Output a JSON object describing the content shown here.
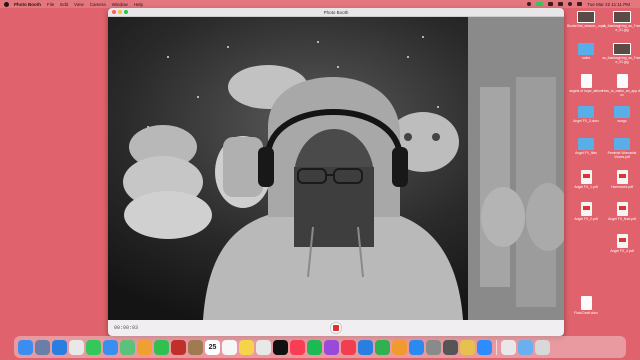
{
  "menubar": {
    "app": "Photo Booth",
    "items": [
      "File",
      "Edit",
      "View",
      "Camera",
      "Window",
      "Help"
    ],
    "clock": "Tue Mar 22 11:11 PM"
  },
  "window": {
    "title": "Photo Booth",
    "timer": "00:00:03"
  },
  "desktop_icons": [
    {
      "label": "Bucket list_season_.mp4",
      "type": "thumb"
    },
    {
      "label": "ss_thanksgiving_ss_Frame_01.jpg",
      "type": "thumb"
    },
    {
      "label": "notes",
      "type": "folder"
    },
    {
      "label": "ss_thanksgiving_ss_Frame_02.jpg",
      "type": "thumb"
    },
    {
      "label": "angels of hope_album",
      "type": "doc"
    },
    {
      "label": "How_to_make_an_app.docx",
      "type": "doc"
    },
    {
      "label": "Angel FX_3.docx",
      "type": "folder"
    },
    {
      "label": "songs",
      "type": "folder"
    },
    {
      "label": "Angel FX_files",
      "type": "folder"
    },
    {
      "label": "Feminist Womanist Voices.pdf",
      "type": "folder"
    },
    {
      "label": "Angel FX_1.pdf",
      "type": "pdf"
    },
    {
      "label": "Homework.pdf",
      "type": "pdf"
    },
    {
      "label": "Angel FX_2.pdf",
      "type": "pdf"
    },
    {
      "label": "Angel FX_final.pdf",
      "type": "pdf"
    },
    {
      "label": "Angel FX_4.pdf",
      "type": "pdf"
    },
    {
      "label": "Final Draft.docx",
      "type": "doc"
    }
  ],
  "dock": [
    {
      "name": "Finder",
      "color": "#3b8ef0"
    },
    {
      "name": "Launchpad",
      "color": "#6a7fa8"
    },
    {
      "name": "Safari",
      "color": "#2a7ee0"
    },
    {
      "name": "Chrome",
      "color": "#e8e8e8"
    },
    {
      "name": "Messages",
      "color": "#34c759"
    },
    {
      "name": "Mail",
      "color": "#3a8ef0"
    },
    {
      "name": "Maps",
      "color": "#5cc17a"
    },
    {
      "name": "Photos",
      "color": "#f0a030"
    },
    {
      "name": "FaceTime",
      "color": "#30c050"
    },
    {
      "name": "Photo Booth",
      "color": "#c0302a"
    },
    {
      "name": "Contacts",
      "color": "#a07a50"
    },
    {
      "name": "Calendar",
      "color": "#ffffff",
      "text": "25"
    },
    {
      "name": "Reminders",
      "color": "#f6f6f6"
    },
    {
      "name": "Notes",
      "color": "#f5d34a"
    },
    {
      "name": "Freeform",
      "color": "#e8e8e8"
    },
    {
      "name": "Apple TV",
      "color": "#111111"
    },
    {
      "name": "Music",
      "color": "#fa3c54"
    },
    {
      "name": "Spotify",
      "color": "#1db954"
    },
    {
      "name": "Podcasts",
      "color": "#9a4ad8"
    },
    {
      "name": "News",
      "color": "#f04050"
    },
    {
      "name": "Keynote",
      "color": "#2a7ee0"
    },
    {
      "name": "Numbers",
      "color": "#30b050"
    },
    {
      "name": "Pages",
      "color": "#f09a30"
    },
    {
      "name": "App Store",
      "color": "#2a8af0"
    },
    {
      "name": "System Settings",
      "color": "#8a8a8a"
    },
    {
      "name": "iPhone Mirroring",
      "color": "#555555"
    },
    {
      "name": "Preview",
      "color": "#e8c050"
    },
    {
      "name": "Zoom",
      "color": "#2d8cff"
    },
    {
      "name": "Photo Library",
      "color": "#e8e8e8"
    },
    {
      "name": "Downloads",
      "color": "#6ab0f0"
    },
    {
      "name": "Trash",
      "color": "#d8d8d8"
    }
  ]
}
